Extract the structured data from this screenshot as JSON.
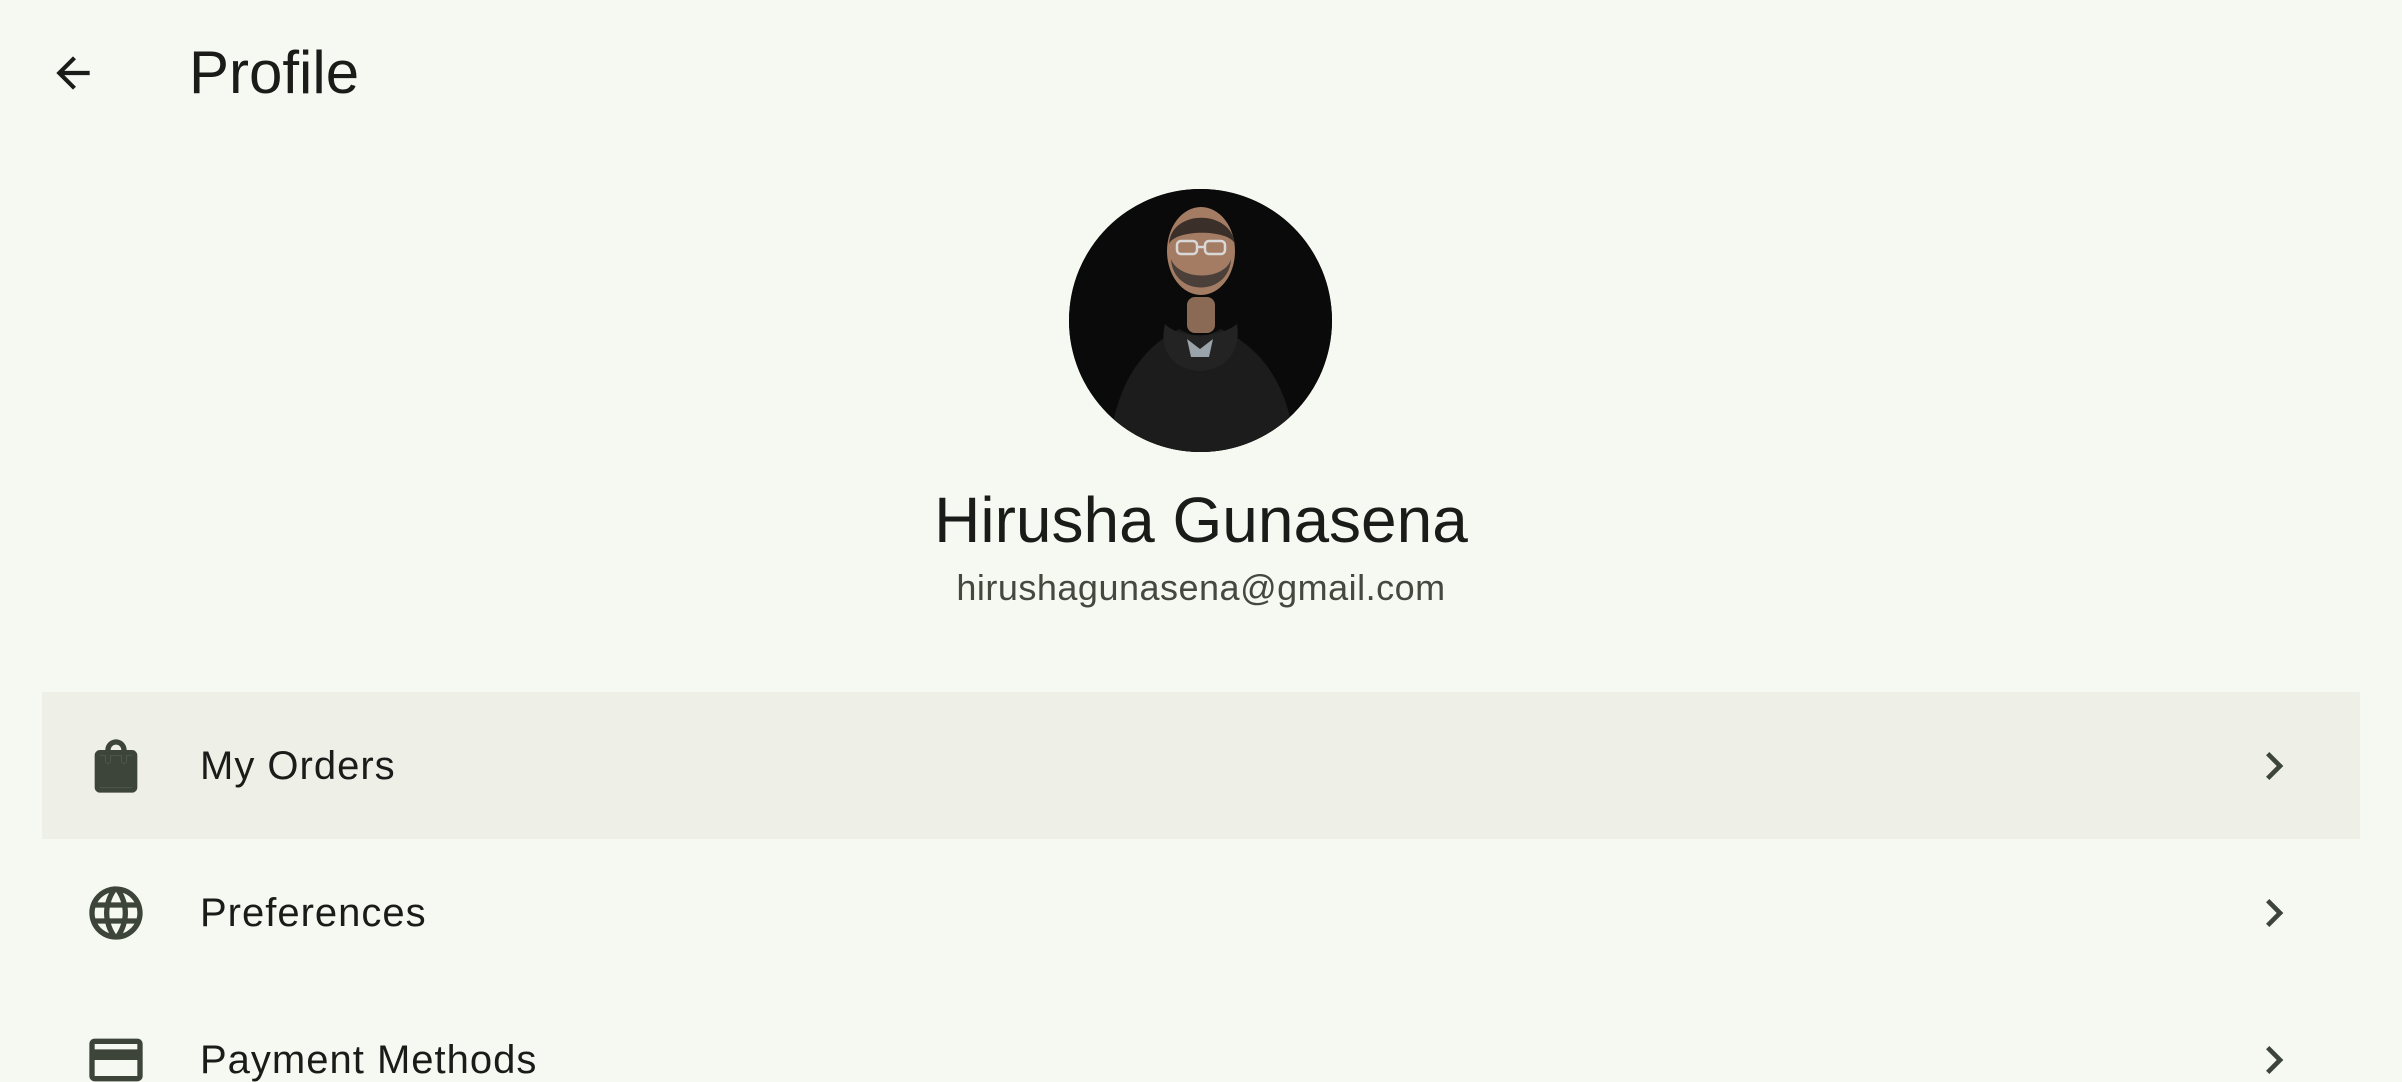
{
  "header": {
    "title": "Profile",
    "back_icon": "arrow-back-icon"
  },
  "profile": {
    "name": "Hirusha Gunasena",
    "email": "hirushagunasena@gmail.com",
    "avatar_icon": "user-avatar-photo"
  },
  "menu": {
    "items": [
      {
        "label": "My Orders",
        "icon": "shopping-bag-icon",
        "selected": true
      },
      {
        "label": "Preferences",
        "icon": "globe-icon",
        "selected": false
      },
      {
        "label": "Payment Methods",
        "icon": "credit-card-icon",
        "selected": false
      }
    ],
    "chevron_icon": "chevron-right-icon"
  },
  "colors": {
    "background": "#f6f9f1",
    "selected_row": "#eef0e8",
    "text_primary": "#1b1c19",
    "text_secondary": "#44483f",
    "icon": "#3d443a"
  }
}
